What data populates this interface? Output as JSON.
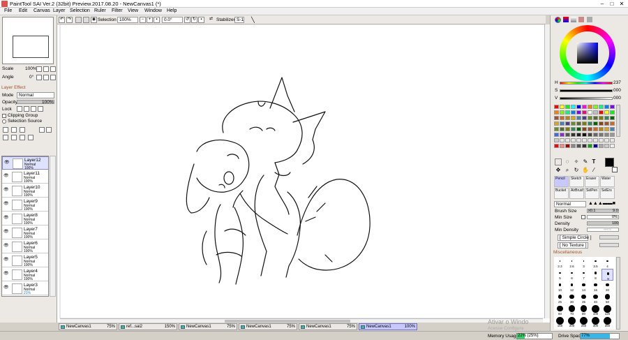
{
  "window": {
    "title": "PaintTool SAI Ver.2 (32bit) Preview.2017.08.20 - NewCanvas1 (*)"
  },
  "menu": [
    "File",
    "Edit",
    "Canvas",
    "Layer",
    "Selection",
    "Ruler",
    "Filter",
    "View",
    "Window",
    "Help"
  ],
  "toolbar": {
    "selection_label": "Selection",
    "zoom": "100%",
    "angle": "0.0°",
    "stabilizer_label": "Stabilizer",
    "stabilizer_value": "S-1"
  },
  "navigator": {
    "scale_label": "Scale",
    "scale_value": "100%",
    "angle_label": "Angle",
    "angle_value": "0°"
  },
  "layer_panel": {
    "effect_label": "Layer Effect",
    "mode_label": "Mode",
    "mode_value": "Normal",
    "opacity_label": "Opacity",
    "opacity_value": "100%",
    "lock_label": "Lock",
    "clipping_label": "Clipping Group",
    "selection_source_label": "Selection Source",
    "layers": [
      {
        "name": "Layer12",
        "mode": "Normal",
        "opacity": "100%"
      },
      {
        "name": "Layer11",
        "mode": "Normal",
        "opacity": "100%"
      },
      {
        "name": "Layer10",
        "mode": "Normal",
        "opacity": "100%"
      },
      {
        "name": "Layer9",
        "mode": "Normal",
        "opacity": "100%"
      },
      {
        "name": "Layer8",
        "mode": "Normal",
        "opacity": "100%"
      },
      {
        "name": "Layer7",
        "mode": "Normal",
        "opacity": "100%"
      },
      {
        "name": "Layer6",
        "mode": "Normal",
        "opacity": "100%"
      },
      {
        "name": "Layer5",
        "mode": "Normal",
        "opacity": "100%"
      },
      {
        "name": "Layer4",
        "mode": "Normal",
        "opacity": "100%"
      },
      {
        "name": "Layer3",
        "mode": "Normal",
        "opacity": "21%"
      }
    ]
  },
  "tabs": [
    {
      "name": "NewCanvas1",
      "zoom": "75%"
    },
    {
      "name": "ref...sai2",
      "zoom": "150%"
    },
    {
      "name": "NewCanvas1",
      "zoom": "75%"
    },
    {
      "name": "NewCanvas1",
      "zoom": "75%"
    },
    {
      "name": "NewCanvas1",
      "zoom": "75%"
    },
    {
      "name": "NewCanvas1",
      "zoom": "100%"
    }
  ],
  "status": {
    "memory_label": "Memory Usage",
    "memory_value": "22% (25%)",
    "drive_label": "Drive Space",
    "drive_value": "77%",
    "watermark": "Ativar o Windo",
    "watermark2": "Acesse Configura"
  },
  "color": {
    "h_label": "H",
    "h_value": "237",
    "s_label": "S",
    "s_value": "000",
    "v_label": "V",
    "v_value": "000",
    "current_hex": "#000000"
  },
  "tools": {
    "brushes": [
      "Pencil",
      "Sketch",
      "Eraser",
      "Water",
      "Bucket",
      "AirBrush",
      "SelPen",
      "SelErs"
    ],
    "brush_mode": "Normal",
    "brush_size_label": "Brush Size",
    "brush_size_x": "x0.1",
    "brush_size_value": "9.0",
    "min_size_label": "Min Size",
    "min_size_value": "0%",
    "density_label": "Density",
    "density_value": "100",
    "min_density_label": "Min Density",
    "min_density_value": "44%",
    "shape": "[ Simple Circle ]",
    "texture": "[ No Texture ]",
    "misc_label": "Miscellaneous",
    "sizes": [
      "2.3",
      "2.6",
      "3",
      "3.5",
      "4",
      "5",
      "6",
      "7",
      "8",
      "9",
      "10",
      "12",
      "14",
      "16",
      "20",
      "25",
      "30",
      "35",
      "40",
      "50",
      "60",
      "70",
      "80",
      "100",
      "120",
      "160",
      "200",
      "250",
      "300",
      "350"
    ]
  },
  "palette_colors": [
    "#ff0000",
    "#ffff00",
    "#00ff00",
    "#00ffff",
    "#0000ff",
    "#ff00ff",
    "#ff8000",
    "#80ff00",
    "#00ff80",
    "#0080ff",
    "#8000ff",
    "#ff0080",
    "#ffffff",
    "#c0c0c0"
  ]
}
